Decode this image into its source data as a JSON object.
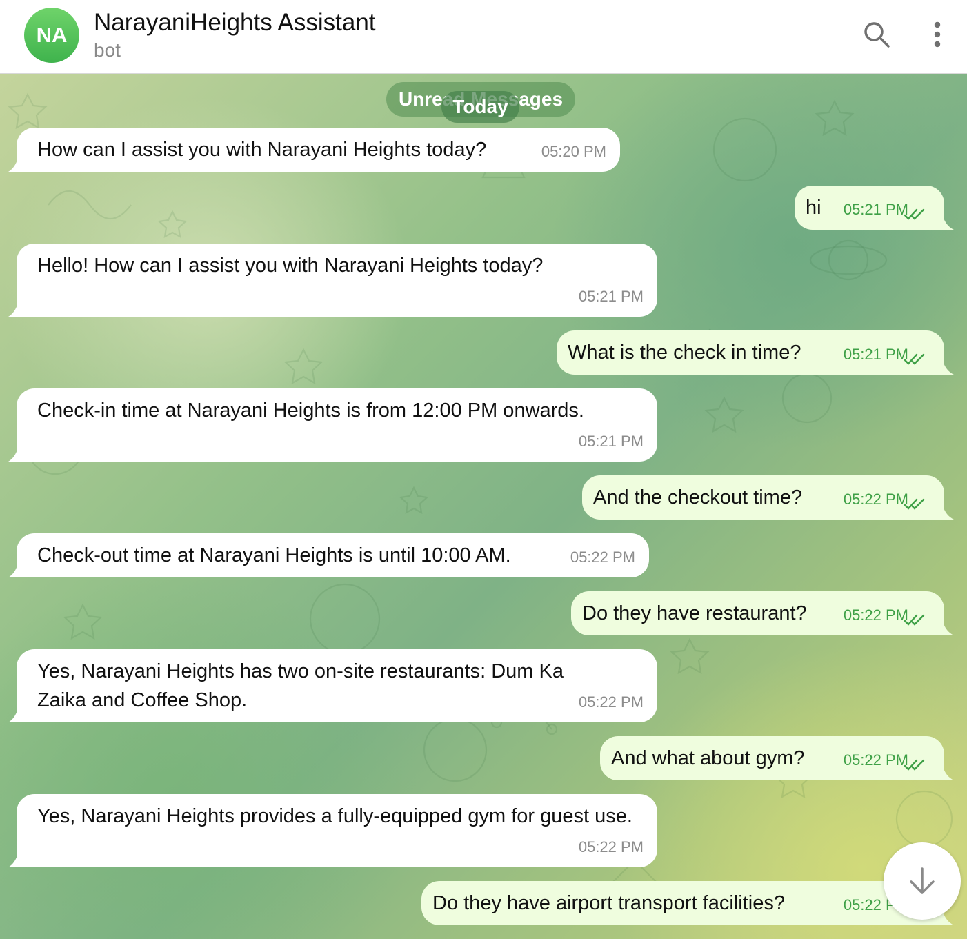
{
  "header": {
    "avatar_initials": "NA",
    "title": "NarayaniHeights Assistant",
    "subtitle": "bot",
    "search_icon": "search-icon",
    "menu_icon": "kebab-menu-icon"
  },
  "chat": {
    "unread_label": "Unread Messages",
    "date_label": "Today",
    "messages": [
      {
        "from": "bot",
        "text": "How can I assist you with Narayani Heights today?",
        "time": "05:20 PM"
      },
      {
        "from": "user",
        "text": "hi",
        "time": "05:21 PM",
        "status": "read"
      },
      {
        "from": "bot",
        "text": "Hello! How can I assist you with Narayani Heights today?",
        "time": "05:21 PM"
      },
      {
        "from": "user",
        "text": "What is the check in time?",
        "time": "05:21 PM",
        "status": "read"
      },
      {
        "from": "bot",
        "text": "Check-in time at Narayani Heights is from 12:00 PM onwards.",
        "time": "05:21 PM"
      },
      {
        "from": "user",
        "text": "And the checkout time?",
        "time": "05:22 PM",
        "status": "read"
      },
      {
        "from": "bot",
        "text": "Check-out time at Narayani Heights is until 10:00 AM.",
        "time": "05:22 PM"
      },
      {
        "from": "user",
        "text": "Do they have restaurant?",
        "time": "05:22 PM",
        "status": "read"
      },
      {
        "from": "bot",
        "text": "Yes, Narayani Heights has two on-site restaurants: Dum Ka Zaika and Coffee Shop.",
        "time": "05:22 PM"
      },
      {
        "from": "user",
        "text": "And what about gym?",
        "time": "05:22 PM",
        "status": "read"
      },
      {
        "from": "bot",
        "text": "Yes, Narayani Heights provides a fully-equipped gym for guest use.",
        "time": "05:22 PM"
      },
      {
        "from": "user",
        "text": "Do they have airport transport facilities?",
        "time": "05:22 PM",
        "status": "read"
      }
    ],
    "scroll_down_icon": "arrow-down-icon"
  },
  "colors": {
    "avatar": "#4cc05a",
    "outgoing_bubble": "#effdde",
    "incoming_bubble": "#ffffff",
    "outgoing_time": "#3ea046"
  }
}
